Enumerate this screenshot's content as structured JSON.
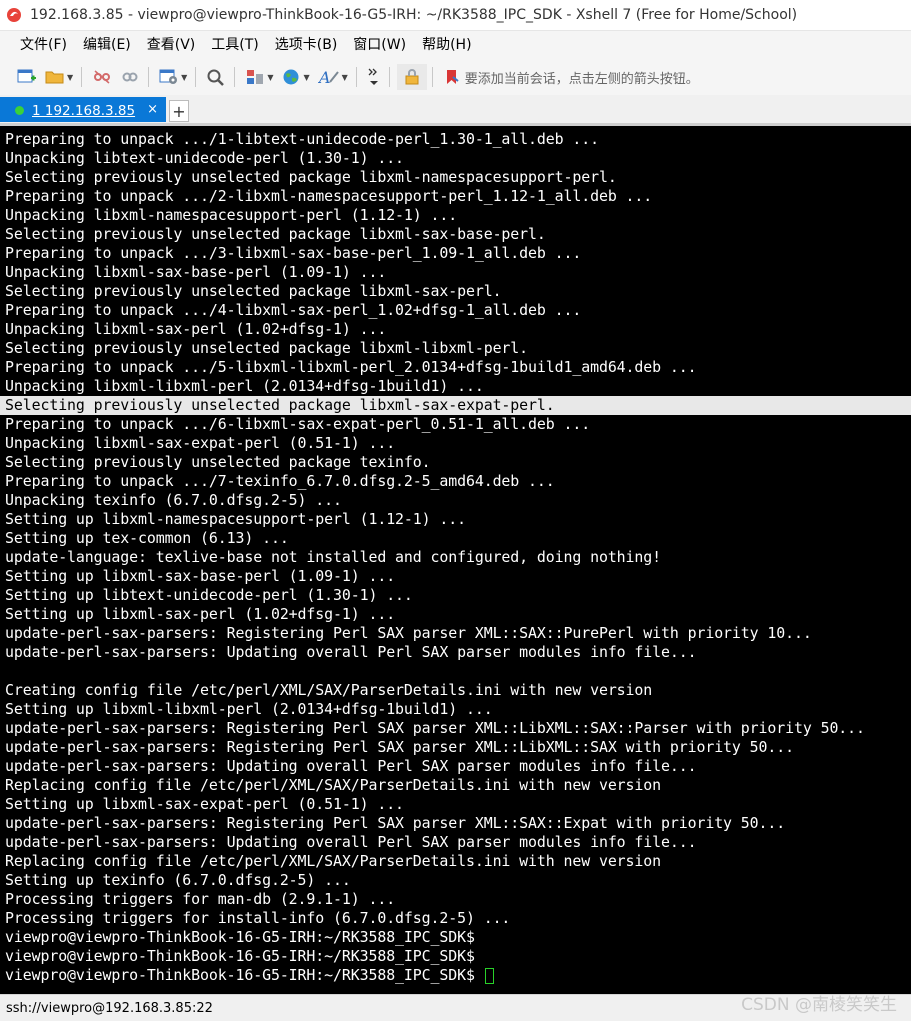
{
  "window": {
    "title": "192.168.3.85 - viewpro@viewpro-ThinkBook-16-G5-IRH: ~/RK3588_IPC_SDK - Xshell 7 (Free for Home/School)"
  },
  "menu": {
    "items": [
      "文件(F)",
      "编辑(E)",
      "查看(V)",
      "工具(T)",
      "选项卡(B)",
      "窗口(W)",
      "帮助(H)"
    ]
  },
  "toolbar": {
    "hint": "要添加当前会话，点击左侧的箭头按钮。"
  },
  "tabs": [
    {
      "label": "1 192.168.3.85",
      "close": "×"
    }
  ],
  "tab_add": "+",
  "terminal": {
    "lines": [
      "Preparing to unpack .../1-libtext-unidecode-perl_1.30-1_all.deb ...",
      "Unpacking libtext-unidecode-perl (1.30-1) ...",
      "Selecting previously unselected package libxml-namespacesupport-perl.",
      "Preparing to unpack .../2-libxml-namespacesupport-perl_1.12-1_all.deb ...",
      "Unpacking libxml-namespacesupport-perl (1.12-1) ...",
      "Selecting previously unselected package libxml-sax-base-perl.",
      "Preparing to unpack .../3-libxml-sax-base-perl_1.09-1_all.deb ...",
      "Unpacking libxml-sax-base-perl (1.09-1) ...",
      "Selecting previously unselected package libxml-sax-perl.",
      "Preparing to unpack .../4-libxml-sax-perl_1.02+dfsg-1_all.deb ...",
      "Unpacking libxml-sax-perl (1.02+dfsg-1) ...",
      "Selecting previously unselected package libxml-libxml-perl.",
      "Preparing to unpack .../5-libxml-libxml-perl_2.0134+dfsg-1build1_amd64.deb ...",
      "Unpacking libxml-libxml-perl (2.0134+dfsg-1build1) ...",
      "Selecting previously unselected package libxml-sax-expat-perl.",
      "Preparing to unpack .../6-libxml-sax-expat-perl_0.51-1_all.deb ...",
      "Unpacking libxml-sax-expat-perl (0.51-1) ...",
      "Selecting previously unselected package texinfo.",
      "Preparing to unpack .../7-texinfo_6.7.0.dfsg.2-5_amd64.deb ...",
      "Unpacking texinfo (6.7.0.dfsg.2-5) ...",
      "Setting up libxml-namespacesupport-perl (1.12-1) ...",
      "Setting up tex-common (6.13) ...",
      "update-language: texlive-base not installed and configured, doing nothing!",
      "Setting up libxml-sax-base-perl (1.09-1) ...",
      "Setting up libtext-unidecode-perl (1.30-1) ...",
      "Setting up libxml-sax-perl (1.02+dfsg-1) ...",
      "update-perl-sax-parsers: Registering Perl SAX parser XML::SAX::PurePerl with priority 10...",
      "update-perl-sax-parsers: Updating overall Perl SAX parser modules info file...",
      "",
      "Creating config file /etc/perl/XML/SAX/ParserDetails.ini with new version",
      "Setting up libxml-libxml-perl (2.0134+dfsg-1build1) ...",
      "update-perl-sax-parsers: Registering Perl SAX parser XML::LibXML::SAX::Parser with priority 50...",
      "update-perl-sax-parsers: Registering Perl SAX parser XML::LibXML::SAX with priority 50...",
      "update-perl-sax-parsers: Updating overall Perl SAX parser modules info file...",
      "Replacing config file /etc/perl/XML/SAX/ParserDetails.ini with new version",
      "Setting up libxml-sax-expat-perl (0.51-1) ...",
      "update-perl-sax-parsers: Registering Perl SAX parser XML::SAX::Expat with priority 50...",
      "update-perl-sax-parsers: Updating overall Perl SAX parser modules info file...",
      "Replacing config file /etc/perl/XML/SAX/ParserDetails.ini with new version",
      "Setting up texinfo (6.7.0.dfsg.2-5) ...",
      "Processing triggers for man-db (2.9.1-1) ...",
      "Processing triggers for install-info (6.7.0.dfsg.2-5) ...",
      "viewpro@viewpro-ThinkBook-16-G5-IRH:~/RK3588_IPC_SDK$",
      "viewpro@viewpro-ThinkBook-16-G5-IRH:~/RK3588_IPC_SDK$",
      "viewpro@viewpro-ThinkBook-16-G5-IRH:~/RK3588_IPC_SDK$ "
    ],
    "highlighted_line_index": 14,
    "colors": {
      "background": "#000000",
      "foreground": "#ffffff",
      "cursor": "#29d129"
    }
  },
  "status": {
    "connection": "ssh://viewpro@192.168.3.85:22"
  },
  "watermark": "CSDN @南棱笑笑生",
  "colors": {
    "tab_active": "#0a78d7",
    "status_dot": "#3ad13a"
  }
}
